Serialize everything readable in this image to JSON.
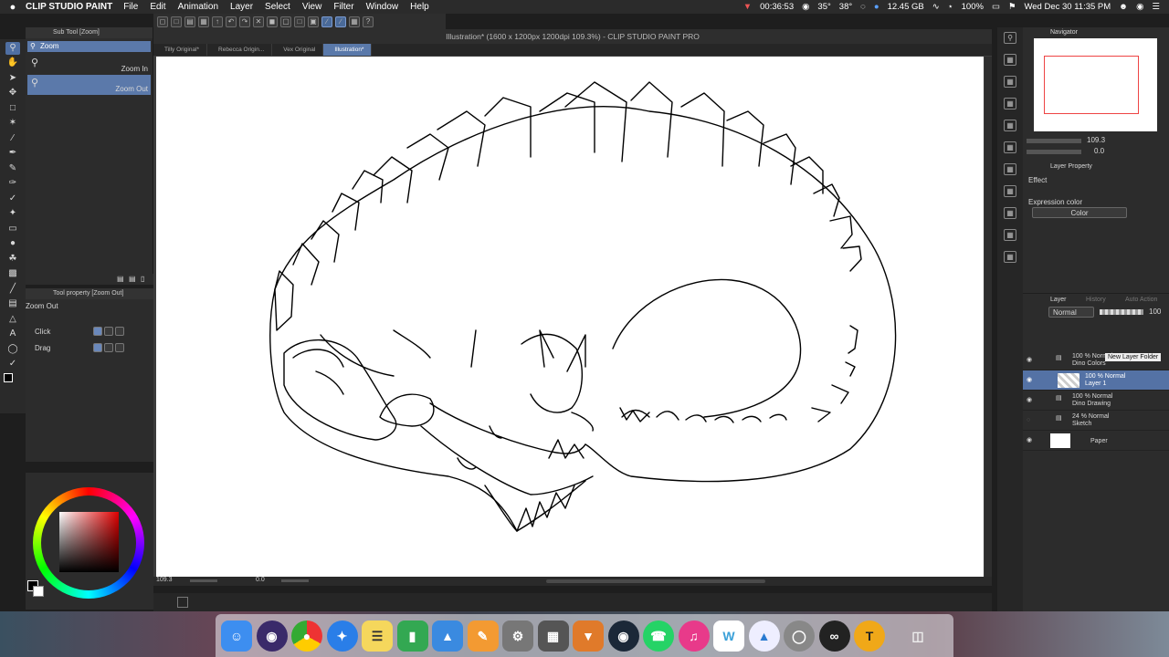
{
  "menubar": {
    "apple": "",
    "app": "CLIP STUDIO PAINT",
    "menus": [
      "File",
      "Edit",
      "Animation",
      "Layer",
      "Select",
      "View",
      "Filter",
      "Window",
      "Help"
    ],
    "time_left": "00:36:53",
    "temp1": "35°",
    "temp2": "38°",
    "memory": "12.45 GB",
    "battery": "100%",
    "datetime": "Wed Dec 30  11:35 PM"
  },
  "subtool": {
    "header": "Sub Tool [Zoom]",
    "group": "Zoom",
    "zoom_in": "Zoom In",
    "zoom_out": "Zoom Out"
  },
  "toolprop": {
    "header": "Tool property [Zoom Out]",
    "title": "Zoom Out",
    "click_label": "Click",
    "drag_label": "Drag"
  },
  "canvas": {
    "title": "Illustration* (1600 x 1200px 1200dpi 109.3%)  - CLIP STUDIO PAINT PRO",
    "tabs": [
      "Tilly Original*",
      "Rebecca Origin...",
      "Vex Original",
      "Illustration*"
    ],
    "zoom": "109.3",
    "angle": "0.0"
  },
  "navigator": {
    "title": "Navigator",
    "zoom": "109.3",
    "angle": "0.0"
  },
  "layer_property": {
    "title": "Layer Property",
    "effect": "Effect",
    "expression_label": "Expression color",
    "expression_value": "Color"
  },
  "layer_panel": {
    "tab_layer": "Layer",
    "tab_history": "History",
    "tab_auto": "Auto Action",
    "blend": "Normal",
    "opacity": "100",
    "tooltip": "New Layer Folder",
    "layers": [
      {
        "mode": "100 % Normal",
        "name": "Dino Colors"
      },
      {
        "mode": "100 % Normal",
        "name": "Layer 1"
      },
      {
        "mode": "100 % Normal",
        "name": "Dino Drawing"
      },
      {
        "mode": "24 % Normal",
        "name": "Sketch"
      },
      {
        "mode": "",
        "name": "Paper"
      }
    ]
  },
  "colors": {
    "accent": "#5472a5",
    "panel": "#2c2c2c"
  }
}
